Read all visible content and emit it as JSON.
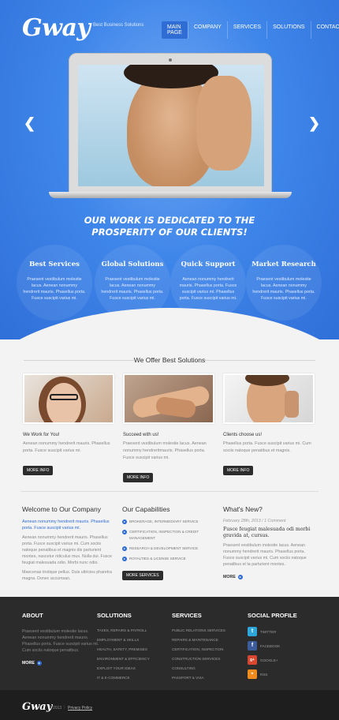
{
  "header": {
    "logo": "Gway",
    "tagline": "Best Business Solutions",
    "nav": [
      "MAIN PAGE",
      "COMPANY",
      "SERVICES",
      "SOLUTIONS",
      "CONTACTS"
    ]
  },
  "hero": {
    "heading": "OUR WORK IS DEDICATED TO THE PROSPERITY OF OUR CLIENTS!",
    "features": [
      {
        "title": "Best Services",
        "text": "Praesent vestibulum molestie lacus. Aenean nonummy hendrerit mauris. Phasellus porta. Fusce suscipit varius mi."
      },
      {
        "title": "Global Solutions",
        "text": "Praesent vestibulum molestie lacus. Aenean nonummy hendrerit mauris. Phasellus porta. Fusce suscipit varius mi."
      },
      {
        "title": "Quick Support",
        "text": "Aenean nonummy hendrerit mauris. Phasellus porta. Fusce suscipit varius mi. Phasellus porta. Fusce suscipit varius mi."
      },
      {
        "title": "Market Research",
        "text": "Praesent vestibulum molestie lacus. Aenean nonummy hendrerit mauris. Phasellus porta. Fusce suscipit varius mi."
      }
    ]
  },
  "offer": {
    "title": "We Offer Best Solutions",
    "cards": [
      {
        "title": "We Work for You!",
        "text": "Aenean nonummy hendrerit mauris. Phasellus porta. Fusce suscipit varius mi.",
        "button": "MORE INFO"
      },
      {
        "title": "Succeed with us!",
        "text": "Praesent vestibulum molestie lacus. Aenean nonummy hendreritmauris. Phasellus porta. Fusce suscipit varius mi.",
        "button": "MORE INFO"
      },
      {
        "title": "Clients choose us!",
        "text": "Phasellus porta. Fusce suscipit varius mi. Cum sociis natoque penatibus et magnis.",
        "button": "MORE INFO"
      }
    ]
  },
  "welcome": {
    "title": "Welcome to Our Company",
    "link_text": "Aenean nonummy hendrerit mauris. Phasellus porta. Fusce suscipit varius mi.",
    "text1": "Aenean nonummy hendrerit mauris. Phasellus porta. Fusce suscipit varius mi. Cum sociis natoque penatibus et magnis dis parturient montes, nascetur ridiculus mus. Nulla dui. Fusce feugiat malesuada odio. Morbi nunc odio.",
    "text2": "Maecenas tristique pellus. Duis ultricies pharetra magna. Donec accumsan."
  },
  "capabilities": {
    "title": "Our Capabilities",
    "items": [
      "BROKERAGE, INTERMEDIARY SERVICE",
      "CERTIFICATION, INSPECTION & CREDIT MANAGEMENT",
      "RESEARCH & DEVELOPMENT SERVICE",
      "ROYALTIES & LICENSE SERVICE"
    ],
    "button": "MORE SERVICES"
  },
  "news": {
    "title": "What's New?",
    "date": "February 28th, 2013",
    "comments": "1 Comment",
    "headline": "Fusce feugiat malesuada odi morbi gravida at, cursus.",
    "text": "Praesent vestibulum molestie lacus. Aenean nonummy hendrerit mauris. Phasellus porta. Fusce suscipit varius mi. Cum sociis natoque penatibus et ta parturient montes.",
    "more": "MORE"
  },
  "footer": {
    "about": {
      "title": "ABOUT",
      "text": "Praesent vestibulum molestie lacus. Aenean nonummy hendrerit mauris. Phasellus porta. Fusce suscipit varius mi. Cum sociis natoque penatibus.",
      "more": "MORE"
    },
    "solutions": {
      "title": "SOLUTIONS",
      "items": [
        "TAXES, REPAIRS & PAYROLL",
        "EMPLOYMENT & SKILLS",
        "HEALTH, SAFETY, PREMISES",
        "ENVIRONMENT & EFFICIENCY",
        "EXPLOIT YOUR IDEAS",
        "IT & E-COMMERCE"
      ]
    },
    "services": {
      "title": "SERVICES",
      "items": [
        "PUBLIC RELATIONS SERVICES",
        "REPAIRS & MAINTENANCE",
        "CERTIFICATION, INSPECTION",
        "CONSTRUCTION SERVICES",
        "CONSULTING",
        "PASSPORT & VISA"
      ]
    },
    "social": {
      "title": "SOCIAL PROFILE",
      "items": [
        {
          "label": "TWITTER",
          "icon": "twitter-icon",
          "color": "#2fa6d9",
          "glyph": "t"
        },
        {
          "label": "FACEBOOK",
          "icon": "facebook-icon",
          "color": "#3b5b9a",
          "glyph": "f"
        },
        {
          "label": "GOOGLE+",
          "icon": "google-plus-icon",
          "color": "#d8462f",
          "glyph": "g+"
        },
        {
          "label": "RSS",
          "icon": "rss-icon",
          "color": "#f08b1d",
          "glyph": "r"
        }
      ]
    }
  },
  "bottom": {
    "logo": "Gway",
    "copyright": "© 2013",
    "policy": "Privacy Policy"
  }
}
